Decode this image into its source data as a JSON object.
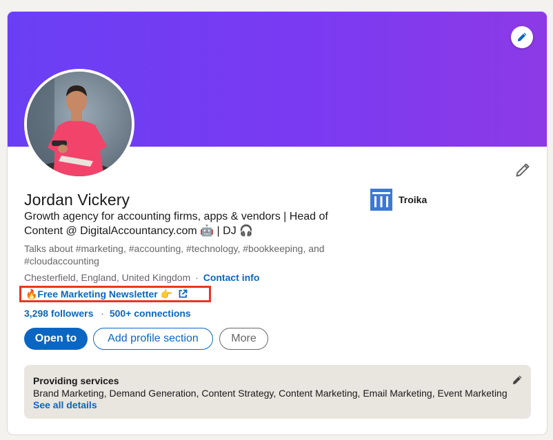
{
  "profile": {
    "name": "Jordan Vickery",
    "headline": "Growth agency for accounting firms, apps & vendors | Head of Content @ DigitalAccountancy.com 🤖 | DJ 🎧",
    "talks_about": "Talks about #marketing, #accounting, #technology, #bookkeeping, and #cloudaccounting",
    "location": "Chesterfield, England, United Kingdom",
    "location_separator": "·",
    "contact_info_label": "Contact info",
    "website_label": "🔥Free Marketing Newsletter 👉",
    "followers_label": "3,298 followers",
    "network_separator": "·",
    "connections_label": "500+ connections"
  },
  "company": {
    "name": "Troika"
  },
  "actions": {
    "open_to_label": "Open to",
    "add_section_label": "Add profile section",
    "more_label": "More"
  },
  "services": {
    "title": "Providing services",
    "list": "Brand Marketing, Demand Generation, Content Strategy, Content Marketing, Email Marketing, Event Marketing",
    "see_all_label": "See all details"
  },
  "icons": {
    "banner_edit": "pencil-icon",
    "intro_edit": "pencil-icon",
    "services_edit": "pencil-icon",
    "external_link": "external-link-icon"
  },
  "colors": {
    "accent": "#0a66c2",
    "banner_start": "#6a3ff4",
    "banner_end": "#8d3ae6",
    "highlight_box": "#e8361f",
    "services_bg": "#e9e5df",
    "company_logo": "#3c78d8"
  }
}
